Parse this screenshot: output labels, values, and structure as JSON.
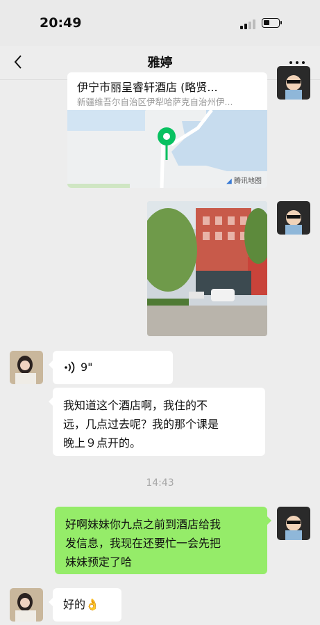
{
  "status_bar": {
    "time": "20:49",
    "battery_level": 0.35
  },
  "header": {
    "title": "雅婷",
    "back_icon": "chevron-left-icon",
    "more_icon": "more-dots-icon"
  },
  "messages": {
    "location": {
      "name": "伊宁市丽呈睿轩酒店 (略贤...",
      "address": "新疆维吾尔自治区伊犁哈萨克自治州伊...",
      "map_brand": "腾讯地图"
    },
    "voice": {
      "duration": "9\""
    },
    "reply_1": {
      "line1": "我知道这个酒店啊，我住的不",
      "line2": "远，几点过去呢？我的那个课是",
      "line3": "晚上９点开的。"
    },
    "timestamp": "14:43",
    "sent_1": {
      "line1": "好啊妹妹你九点之前到酒店给我",
      "line2": "发信息，我现在还要忙一会先把",
      "line3": "妹妹预定了哈"
    },
    "reply_2": {
      "text": "好的",
      "emoji": "👌"
    }
  },
  "colors": {
    "sent_bubble": "#95ec69",
    "received_bubble": "#ffffff",
    "background": "#ededed"
  }
}
